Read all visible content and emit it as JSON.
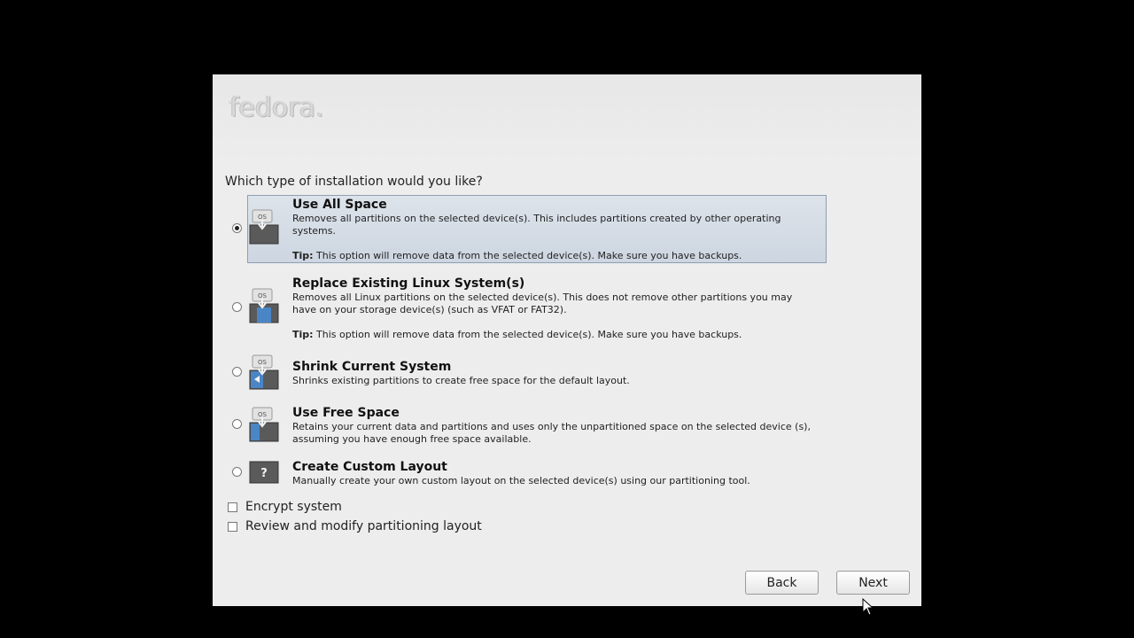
{
  "logo_text": "fedora.",
  "question": "Which type of installation would you like?",
  "options": [
    {
      "title": "Use All Space",
      "desc": "Removes all partitions on the selected device(s).  This includes partitions created by other operating systems.",
      "tip_label": "Tip:",
      "tip": " This option will remove data from the selected device(s).  Make sure you have backups.",
      "icon": "disk-os-arrow-icon"
    },
    {
      "title": "Replace Existing Linux System(s)",
      "desc": "Removes all Linux partitions on the selected device(s). This does not remove other partitions you may have on your storage device(s) (such as VFAT or FAT32).",
      "tip_label": "Tip:",
      "tip": " This option will remove data from the selected device(s).  Make sure you have backups.",
      "icon": "disk-replace-icon"
    },
    {
      "title": "Shrink Current System",
      "desc": "Shrinks existing partitions to create free space for the default layout.",
      "icon": "disk-shrink-icon"
    },
    {
      "title": "Use Free Space",
      "desc": "Retains your current data and partitions and uses only the unpartitioned space on the selected device (s), assuming you have enough free space available.",
      "icon": "disk-free-space-icon"
    },
    {
      "title": "Create Custom Layout",
      "desc": "Manually create your own custom layout on the selected device(s) using our partitioning tool.",
      "icon": "custom-layout-question-icon",
      "icon_glyph": "?"
    }
  ],
  "selected_option": "Use All Space",
  "os_badge": "OS",
  "checkboxes": {
    "encrypt": "Encrypt system",
    "review": "Review and modify partitioning layout"
  },
  "buttons": {
    "back": "Back",
    "next": "Next"
  },
  "colors": {
    "selected_bg": "#d4dce6",
    "selected_border": "#8e9fb4",
    "window_bg": "#ededed"
  }
}
